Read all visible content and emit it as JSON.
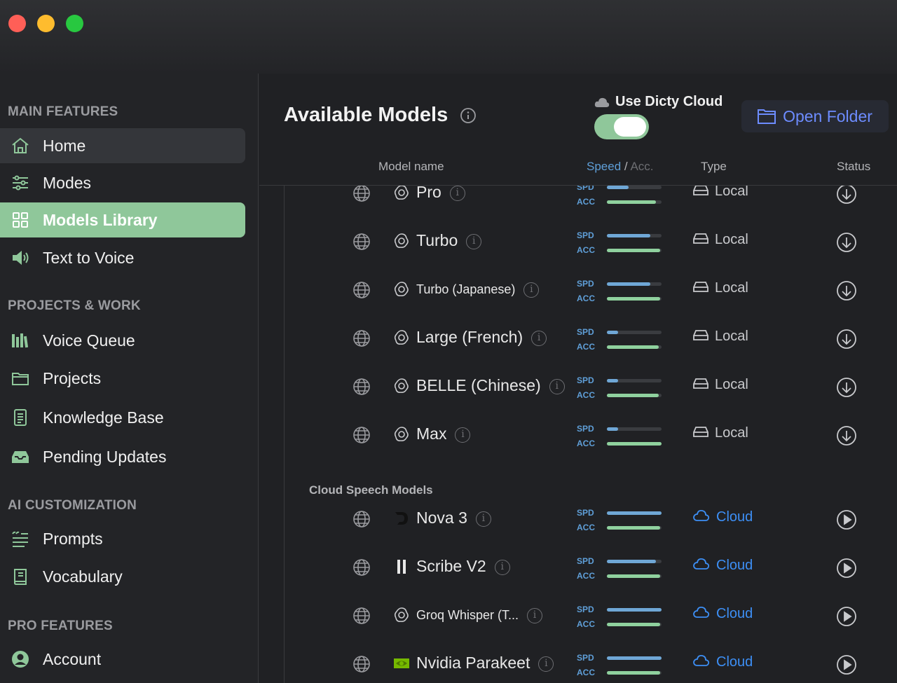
{
  "sidebar": {
    "sections": [
      {
        "title": "MAIN FEATURES"
      },
      {
        "title": "PROJECTS & WORK"
      },
      {
        "title": "AI CUSTOMIZATION"
      },
      {
        "title": "PRO FEATURES"
      }
    ],
    "items": [
      {
        "label": "Home",
        "icon": "home-icon"
      },
      {
        "label": "Modes",
        "icon": "sliders-icon"
      },
      {
        "label": "Models Library",
        "icon": "grid-icon",
        "active": true
      },
      {
        "label": "Text to Voice",
        "icon": "speaker-icon"
      },
      {
        "label": "Voice Queue",
        "icon": "books-icon"
      },
      {
        "label": "Projects",
        "icon": "folder-icon"
      },
      {
        "label": "Knowledge Base",
        "icon": "document-icon"
      },
      {
        "label": "Pending Updates",
        "icon": "inbox-icon"
      },
      {
        "label": "Prompts",
        "icon": "quote-list-icon"
      },
      {
        "label": "Vocabulary",
        "icon": "book-icon"
      },
      {
        "label": "Account",
        "icon": "person-icon"
      }
    ]
  },
  "header": {
    "title": "Available Models",
    "cloud_toggle_label": "Use Dicty Cloud",
    "cloud_toggle_on": true,
    "open_folder_label": "Open Folder"
  },
  "columns": {
    "model_name": "Model name",
    "speed": "Speed",
    "slash": "/",
    "acc": "Acc.",
    "type": "Type",
    "status": "Status"
  },
  "labels": {
    "spd": "SPD",
    "acc": "ACC"
  },
  "local_models": [
    {
      "name": "Pro",
      "provider_icon": "openai-icon",
      "speed": 0.4,
      "accuracy": 0.9,
      "type": "Local",
      "status_icon": "download-icon"
    },
    {
      "name": "Turbo",
      "provider_icon": "openai-icon",
      "speed": 0.8,
      "accuracy": 0.98,
      "type": "Local",
      "status_icon": "download-icon"
    },
    {
      "name": "Turbo (Japanese)",
      "provider_icon": "openai-icon",
      "speed": 0.8,
      "accuracy": 0.98,
      "type": "Local",
      "status_icon": "download-icon"
    },
    {
      "name": "Large (French)",
      "provider_icon": "openai-icon",
      "speed": 0.2,
      "accuracy": 0.95,
      "type": "Local",
      "status_icon": "download-icon"
    },
    {
      "name": "BELLE (Chinese)",
      "provider_icon": "openai-icon",
      "speed": 0.2,
      "accuracy": 0.95,
      "type": "Local",
      "status_icon": "download-icon"
    },
    {
      "name": "Max",
      "provider_icon": "openai-icon",
      "speed": 0.2,
      "accuracy": 1.0,
      "type": "Local",
      "status_icon": "download-icon"
    }
  ],
  "cloud_section_title": "Cloud Speech Models",
  "cloud_models": [
    {
      "name": "Nova 3",
      "provider_icon": "deepgram-icon",
      "speed": 1.0,
      "accuracy": 0.98,
      "type": "Cloud",
      "status_icon": "play-icon"
    },
    {
      "name": "Scribe V2",
      "provider_icon": "elevenlabs-icon",
      "speed": 0.9,
      "accuracy": 0.98,
      "type": "Cloud",
      "status_icon": "play-icon"
    },
    {
      "name": "Groq Whisper (T...",
      "provider_icon": "openai-icon",
      "speed": 1.0,
      "accuracy": 0.98,
      "type": "Cloud",
      "status_icon": "play-icon"
    },
    {
      "name": "Nvidia Parakeet",
      "provider_icon": "nvidia-icon",
      "speed": 1.0,
      "accuracy": 0.98,
      "type": "Cloud",
      "status_icon": "play-icon"
    }
  ],
  "colors": {
    "accent_green": "#8fc79a",
    "cloud_blue": "#3d8ff5",
    "folder_blue": "#6d8cff",
    "speed_bar": "#6fa7d6",
    "accuracy_bar": "#8fd19e"
  }
}
